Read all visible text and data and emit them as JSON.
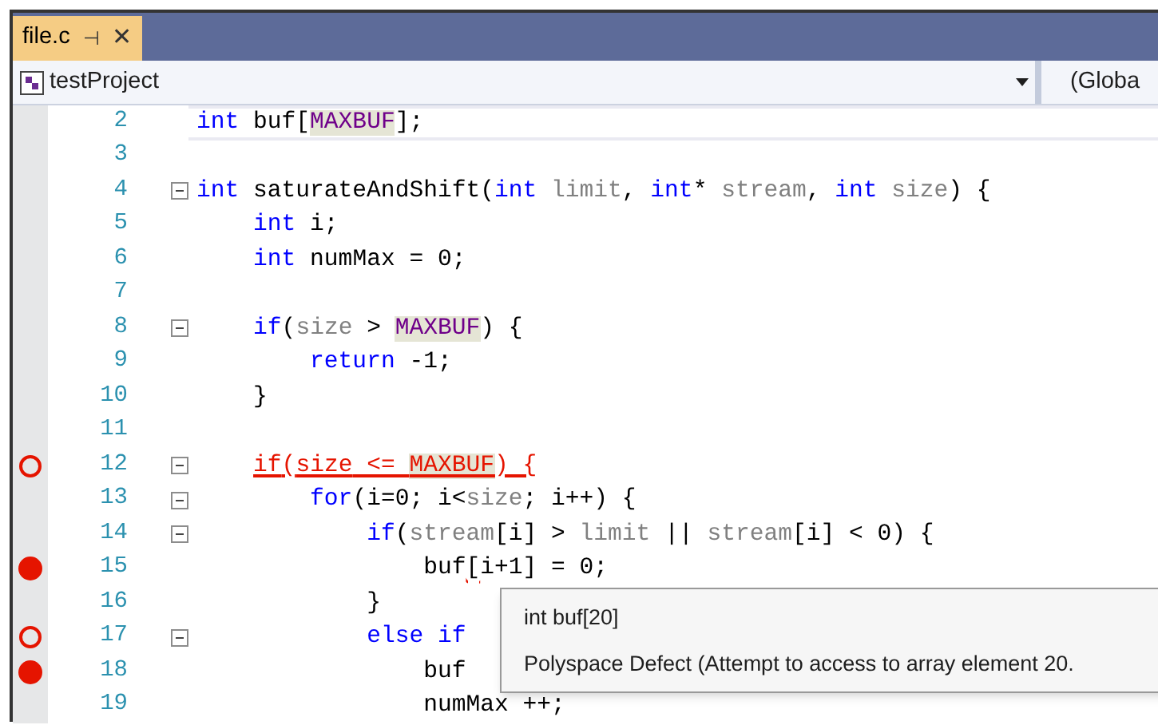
{
  "tab": {
    "title": "file.c",
    "pin_glyph": "⊣",
    "close_glyph": "✕",
    "selected": true
  },
  "nav_bar": {
    "project": "testProject",
    "scope": "(Globa"
  },
  "lines": [
    {
      "number": "2",
      "kind": "plain",
      "current": true,
      "foldable": false,
      "error": false,
      "tokens": [
        {
          "kind": "kw",
          "text": "int"
        },
        {
          "kind": "plain",
          "text": " buf["
        },
        {
          "kind": "macro",
          "text": "MAXBUF"
        },
        {
          "kind": "plain",
          "text": "];"
        }
      ]
    },
    {
      "number": "3",
      "kind": "plain",
      "current": false,
      "foldable": false,
      "error": false
    },
    {
      "number": "4",
      "kind": "plain",
      "current": false,
      "foldable": true,
      "error": false,
      "tokens": [
        {
          "kind": "kw",
          "text": "int"
        },
        {
          "kind": "plain",
          "text": " saturateAndShift("
        },
        {
          "kind": "kw",
          "text": "int"
        },
        {
          "kind": "param",
          "text": " limit"
        },
        {
          "kind": "plain",
          "text": ", "
        },
        {
          "kind": "kw",
          "text": "int"
        },
        {
          "kind": "plain",
          "text": "* "
        },
        {
          "kind": "param",
          "text": "stream"
        },
        {
          "kind": "plain",
          "text": ", "
        },
        {
          "kind": "kw",
          "text": "int"
        },
        {
          "kind": "param",
          "text": " size"
        },
        {
          "kind": "plain",
          "text": ") {"
        }
      ]
    },
    {
      "number": "5",
      "kind": "plain",
      "current": false,
      "foldable": false,
      "error": false,
      "tokens": [
        {
          "kind": "kw",
          "text": "    int"
        },
        {
          "kind": "plain",
          "text": " i;"
        }
      ]
    },
    {
      "number": "6",
      "kind": "plain",
      "current": false,
      "foldable": false,
      "error": false,
      "tokens": [
        {
          "kind": "kw",
          "text": "    int"
        },
        {
          "kind": "plain",
          "text": " numMax = 0;"
        }
      ]
    },
    {
      "number": "7",
      "kind": "plain",
      "current": false,
      "foldable": false,
      "error": false
    },
    {
      "number": "8",
      "kind": "plain",
      "current": false,
      "foldable": true,
      "error": false,
      "tokens": [
        {
          "kind": "kw",
          "text": "    if"
        },
        {
          "kind": "plain",
          "text": "("
        },
        {
          "kind": "param",
          "text": "size"
        },
        {
          "kind": "plain",
          "text": " > "
        },
        {
          "kind": "macro",
          "text": "MAXBUF"
        },
        {
          "kind": "plain",
          "text": ") {"
        }
      ]
    },
    {
      "number": "9",
      "kind": "plain",
      "current": false,
      "foldable": false,
      "error": false,
      "tokens": [
        {
          "kind": "kw",
          "text": "        return"
        },
        {
          "kind": "plain",
          "text": " -1;"
        }
      ]
    },
    {
      "number": "10",
      "kind": "plain",
      "current": false,
      "foldable": false,
      "error": false,
      "tokens": [
        {
          "kind": "plain",
          "text": "    }"
        }
      ]
    },
    {
      "number": "11",
      "kind": "plain",
      "current": false,
      "foldable": false,
      "error": false
    },
    {
      "number": "12",
      "kind": "hollow",
      "current": false,
      "foldable": true,
      "error": true,
      "tokens": [
        {
          "kind": "kw",
          "text": "    if"
        },
        {
          "kind": "plain",
          "text": "("
        },
        {
          "kind": "param",
          "text": "size"
        },
        {
          "kind": "plain",
          "text": " <= "
        },
        {
          "kind": "macro",
          "text": "MAXBUF"
        },
        {
          "kind": "plain",
          "text": ") {"
        }
      ]
    },
    {
      "number": "13",
      "kind": "plain",
      "current": false,
      "foldable": true,
      "error": false,
      "tokens": [
        {
          "kind": "kw",
          "text": "        for"
        },
        {
          "kind": "plain",
          "text": "(i=0; i<"
        },
        {
          "kind": "param",
          "text": "size"
        },
        {
          "kind": "plain",
          "text": "; i++) {"
        }
      ]
    },
    {
      "number": "14",
      "kind": "plain",
      "current": false,
      "foldable": true,
      "error": false,
      "tokens": [
        {
          "kind": "kw",
          "text": "            if"
        },
        {
          "kind": "plain",
          "text": "("
        },
        {
          "kind": "param",
          "text": "stream"
        },
        {
          "kind": "plain",
          "text": "[i] > "
        },
        {
          "kind": "param",
          "text": "limit"
        },
        {
          "kind": "plain",
          "text": " || "
        },
        {
          "kind": "param",
          "text": "stream"
        },
        {
          "kind": "plain",
          "text": "[i] < 0) {"
        }
      ]
    },
    {
      "number": "15",
      "kind": "filled",
      "current": false,
      "foldable": false,
      "error": false,
      "tokens": [
        {
          "kind": "plain",
          "text": "                buf"
        },
        {
          "kind": "squiggle",
          "text": "["
        },
        {
          "kind": "plain",
          "text": "i+1] = 0;"
        }
      ]
    },
    {
      "number": "16",
      "kind": "plain",
      "current": false,
      "foldable": false,
      "error": false,
      "tokens": [
        {
          "kind": "plain",
          "text": "            }"
        }
      ]
    },
    {
      "number": "17",
      "kind": "hollow",
      "current": false,
      "foldable": true,
      "error": false,
      "tokens": [
        {
          "kind": "kw",
          "text": "            else if"
        }
      ]
    },
    {
      "number": "18",
      "kind": "filled",
      "current": false,
      "foldable": false,
      "error": false,
      "tokens": [
        {
          "kind": "plain",
          "text": "                buf"
        }
      ]
    },
    {
      "number": "19",
      "kind": "plain",
      "current": false,
      "foldable": false,
      "error": false,
      "tokens": [
        {
          "kind": "plain",
          "text": "                numMax ++;"
        }
      ]
    }
  ],
  "tooltip": {
    "lines": [
      "int buf[20]",
      "Polyspace Defect (Attempt to access to array element 20."
    ]
  }
}
